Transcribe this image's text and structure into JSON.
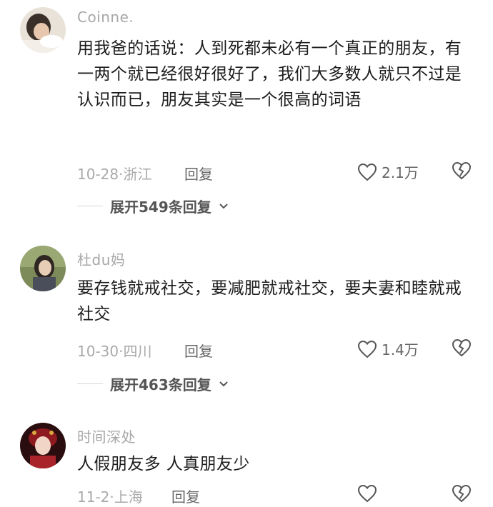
{
  "comments": [
    {
      "username": "Coinne.",
      "text": "用我爸的话说：人到死都未必有一个真正的朋友，有一两个就已经很好很好了，我们大多数人就只不过是认识而已，朋友其实是一个很高的词语",
      "date": "10-28·",
      "location": "浙江",
      "reply_label": "回复",
      "likes": "2.1万",
      "expand_label": "展开549条回复"
    },
    {
      "username": "杜du妈",
      "text": "要存钱就戒社交，要减肥就戒社交，要夫妻和睦就戒社交",
      "date": "10-30·",
      "location": "四川",
      "reply_label": "回复",
      "likes": "1.4万",
      "expand_label": "展开463条回复"
    },
    {
      "username": "时间深处",
      "text": "人假朋友多 人真朋友少",
      "date": "11-2·",
      "location": "上海",
      "reply_label": "回复",
      "likes": ""
    }
  ],
  "icons": {
    "like": "heart-outline-icon",
    "dislike": "broken-heart-icon",
    "expand": "chevron-down-icon"
  },
  "colors": {
    "username": "#a7a7a7",
    "text": "#1c1c1c",
    "meta": "#a9a9a9"
  }
}
